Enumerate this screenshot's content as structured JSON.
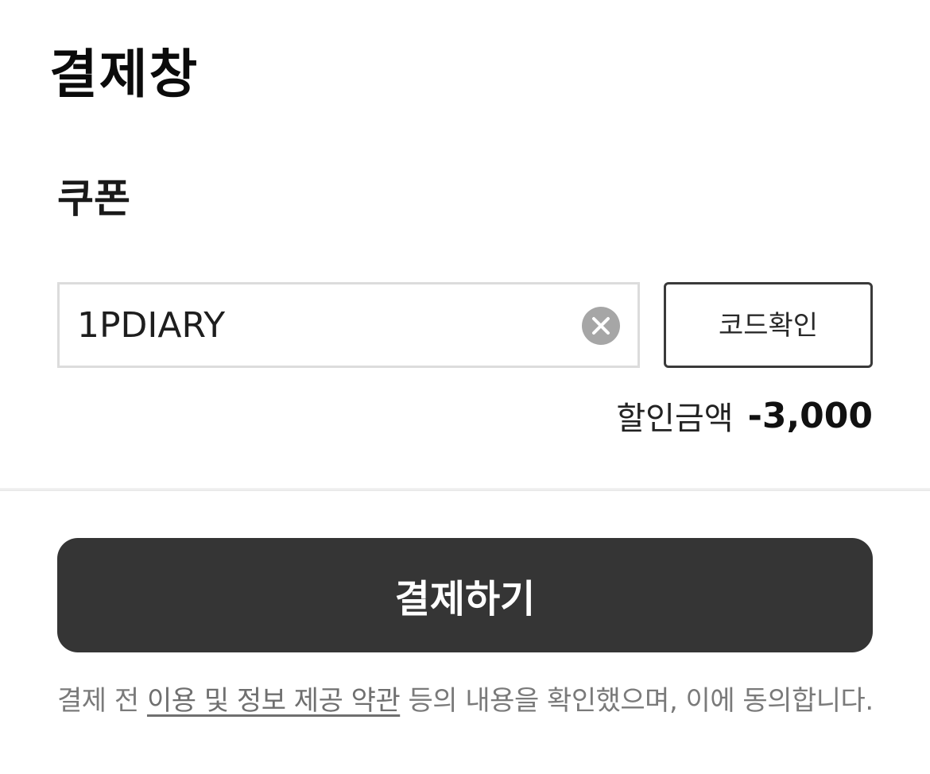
{
  "header": {
    "title": "결제창"
  },
  "coupon": {
    "section_title": "쿠폰",
    "input_value": "1PDIARY",
    "clear_icon": "close-circle-icon",
    "check_button_label": "코드확인",
    "discount_label": "할인금액",
    "discount_amount": "-3,000"
  },
  "payment": {
    "pay_button_label": "결제하기"
  },
  "terms": {
    "prefix": "결제 전 ",
    "link_text": "이용 및 정보 제공 약관",
    "suffix": " 등의 내용을 확인했으며, 이에 동의합니다."
  },
  "colors": {
    "pay_button_bg": "#353535",
    "input_border": "#dcdcdc",
    "clear_icon_bg": "#a6a6a6",
    "notice_text": "#7a7a7a"
  }
}
